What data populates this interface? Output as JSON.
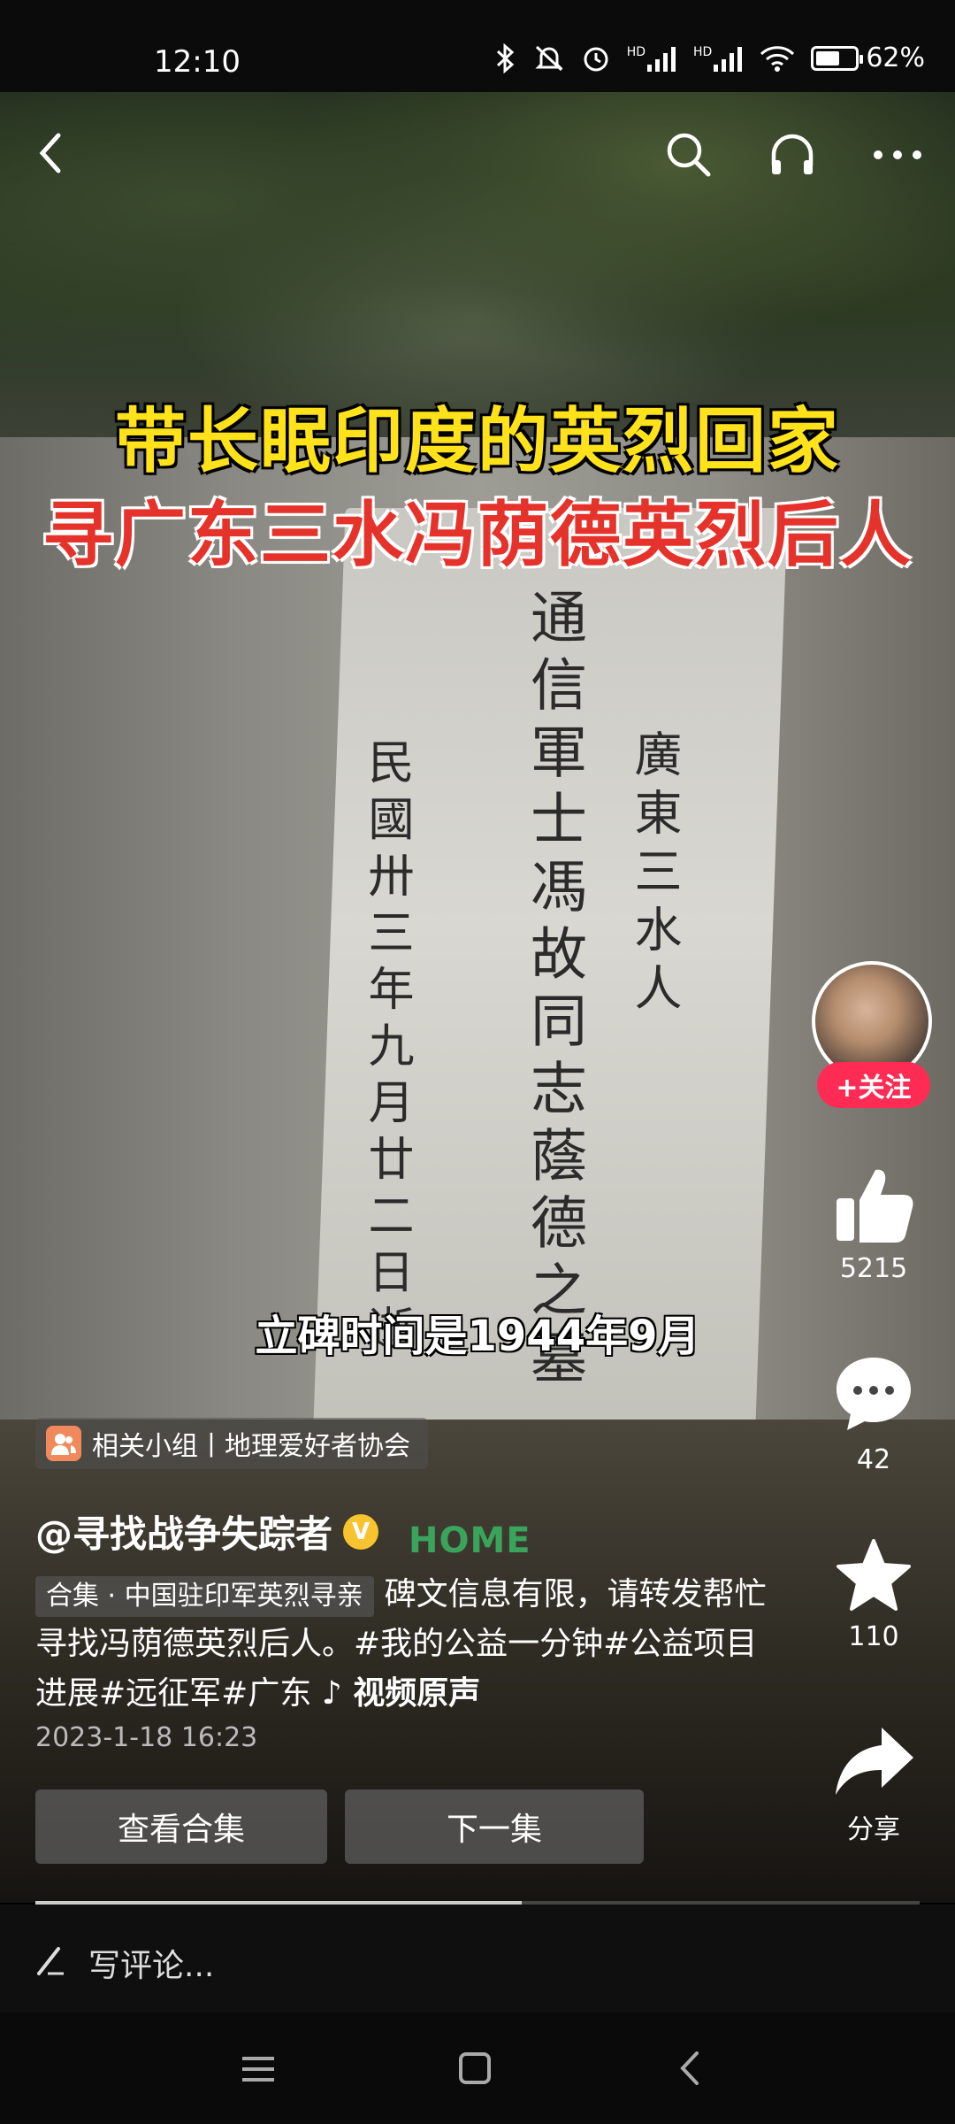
{
  "status_bar": {
    "time": "12:10",
    "battery": "62%",
    "battery_level": 0.62,
    "icons": [
      "bluetooth-icon",
      "mute-icon",
      "alarm-icon",
      "hd-signal-icon",
      "hd-signal-icon",
      "wifi-icon",
      "battery-icon"
    ],
    "hd1": "HD",
    "hd2": "HD"
  },
  "top_bar": {
    "icons": [
      "back-icon",
      "search-icon",
      "headphone-icon",
      "more-icon"
    ]
  },
  "video": {
    "title_line1": "带长眠印度的英烈回家",
    "title_line2": "寻广东三水冯荫德英烈后人",
    "subtitle": "立碑时间是1944年9月",
    "inscription_main": "通信軍士馮故同志蔭德之墓",
    "inscription_right": "廣東三水人",
    "inscription_left": "民國卅三年九月廿二日逝"
  },
  "sidebar": {
    "follow_label": "+关注",
    "like_count": "5215",
    "comment_count": "42",
    "favorite_count": "110",
    "share_label": "分享"
  },
  "info": {
    "group_tag": "相关小组丨地理爱好者协会",
    "author": "@寻找战争失踪者",
    "verified": "V",
    "logo_text": "HOME",
    "collection_chip": "合集 · 中国驻印军英烈寻亲",
    "description": "碑文信息有限，请转发帮忙寻找冯荫德英烈后人。#我的公益一分钟#公益项目进展#远征军#广东",
    "music": "♪ 视频原声",
    "date": "2023-1-18 16:23",
    "btn_collection": "查看合集",
    "btn_next": "下一集",
    "progress": 0.55
  },
  "comment_bar": {
    "placeholder": "写评论..."
  },
  "nav_bar": {
    "icons": [
      "menu-icon",
      "home-icon",
      "back-nav-icon"
    ]
  },
  "colors": {
    "title_yellow": "#ffe21a",
    "title_red": "#e5322a",
    "follow_red": "#fe2c55",
    "verified_gold": "#f7c32e"
  }
}
